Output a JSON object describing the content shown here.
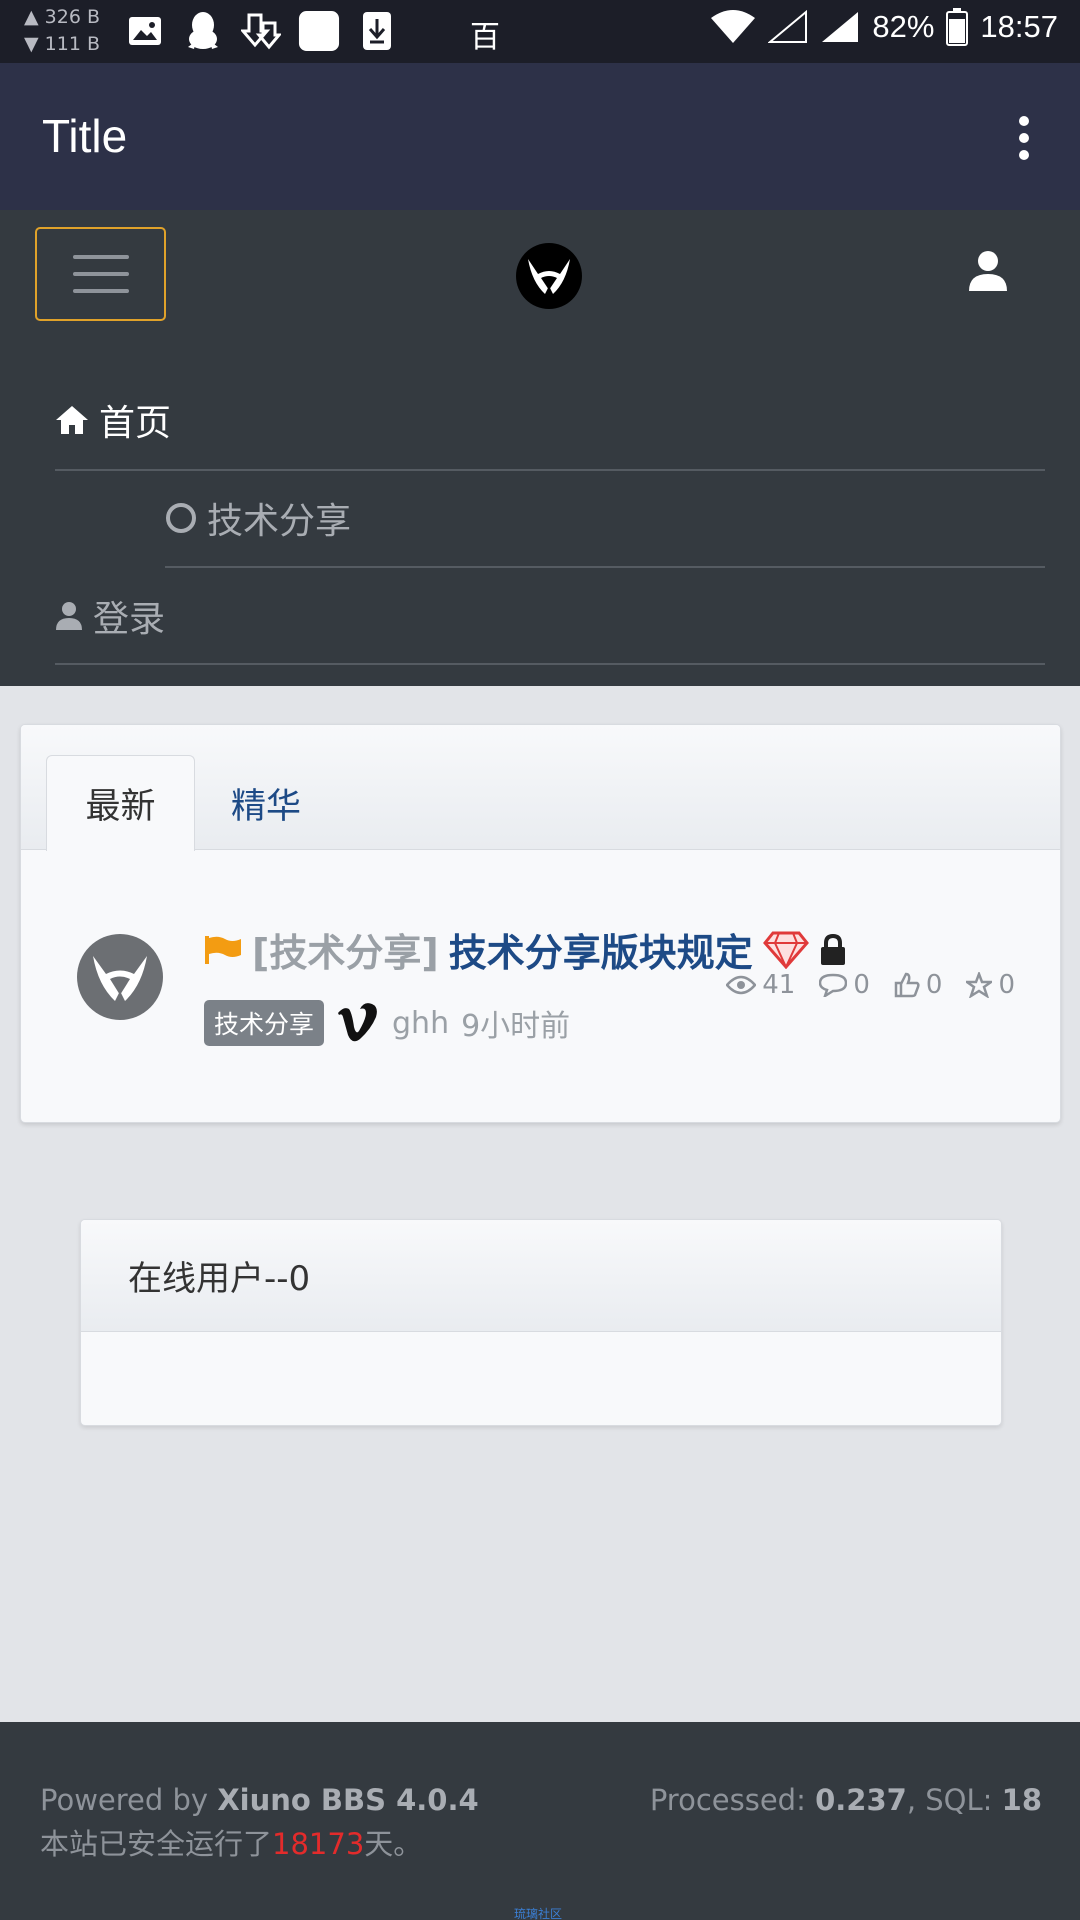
{
  "status_bar": {
    "speed_up": "▲ 326 B",
    "speed_down": "▼ 111 B",
    "center_text": "百",
    "battery": "82%",
    "time": "18:57",
    "icons": [
      "image-icon",
      "qq-icon",
      "download-icon",
      "blank-app-icon",
      "install-icon",
      "wifi-icon",
      "signal-icon",
      "battery-icon"
    ]
  },
  "app_bar": {
    "title": "Title"
  },
  "nav": {
    "home": "首页",
    "tech": "技术分享",
    "login": "登录"
  },
  "tabs": [
    {
      "label": "最新",
      "active": true
    },
    {
      "label": "精华",
      "active": false
    }
  ],
  "thread": {
    "forum": "[技术分享]",
    "subject": "技术分享版块规定",
    "tag": "技术分享",
    "author": "ghh",
    "time": "9小时前",
    "views": "41",
    "comments": "0",
    "likes": "0",
    "favorites": "0"
  },
  "online": {
    "title": "在线用户--0"
  },
  "footer": {
    "powered_prefix": "Powered by ",
    "powered_name": "Xiuno BBS 4.0.4",
    "run_prefix": " 本站已安全运行了",
    "days": "18173",
    "run_suffix": "天。",
    "processed_label": "Processed: ",
    "processed_value": "0.237",
    "sql_label": ", SQL: ",
    "sql_value": "18",
    "tiny_link": "琉璃社区"
  },
  "colors": {
    "app_bar": "#2d3148",
    "nav_bg": "#343a40",
    "link_blue": "#1d4a86",
    "toggler_border": "#e0a22a",
    "flag": "#f39c12",
    "diamond": "#e03a3a"
  }
}
